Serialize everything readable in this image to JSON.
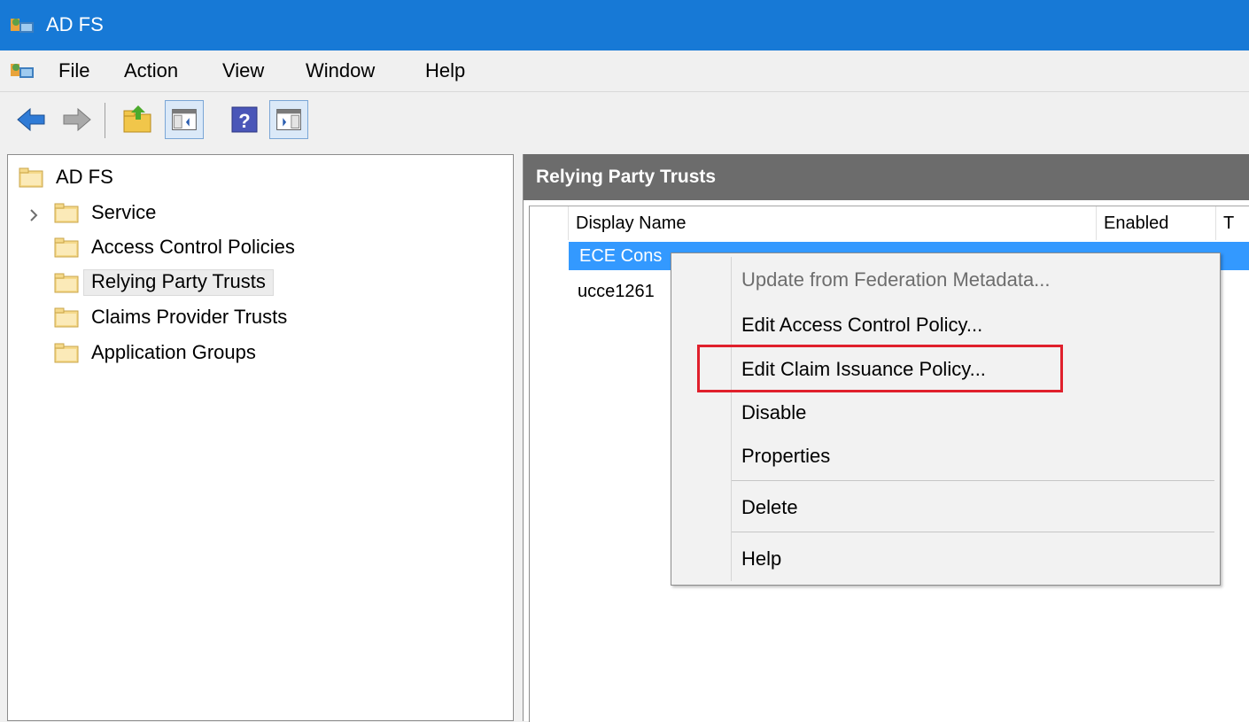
{
  "window": {
    "title": "AD FS"
  },
  "menu": {
    "items": [
      "File",
      "Action",
      "View",
      "Window",
      "Help"
    ]
  },
  "toolbar": {
    "buttons": [
      "back-icon",
      "forward-icon",
      "up-folder-icon",
      "show-hide-console-tree-icon",
      "help-icon",
      "show-hide-action-pane-icon"
    ]
  },
  "tree": {
    "root": "AD FS",
    "items": [
      {
        "label": "Service",
        "expandable": true
      },
      {
        "label": "Access Control Policies"
      },
      {
        "label": "Relying Party Trusts",
        "selected": true
      },
      {
        "label": "Claims Provider Trusts"
      },
      {
        "label": "Application Groups"
      }
    ]
  },
  "right_pane": {
    "title": "Relying Party Trusts",
    "columns": [
      "Display Name",
      "Enabled",
      "T"
    ],
    "rows": [
      {
        "name": "ECE Cons",
        "selected": true
      },
      {
        "name": "ucce1261"
      }
    ]
  },
  "context_menu": {
    "items": [
      {
        "label": "Update from Federation Metadata...",
        "disabled": true
      },
      {
        "label": "Edit Access Control Policy..."
      },
      {
        "label": "Edit Claim Issuance Policy...",
        "highlighted": true
      },
      {
        "label": "Disable"
      },
      {
        "label": "Properties"
      },
      {
        "label": "Delete"
      },
      {
        "label": "Help"
      }
    ]
  },
  "colors": {
    "titlebar": "#1779d6",
    "selection": "#3399ff",
    "highlight_box": "#e0202c",
    "pane_header": "#6c6c6c"
  }
}
